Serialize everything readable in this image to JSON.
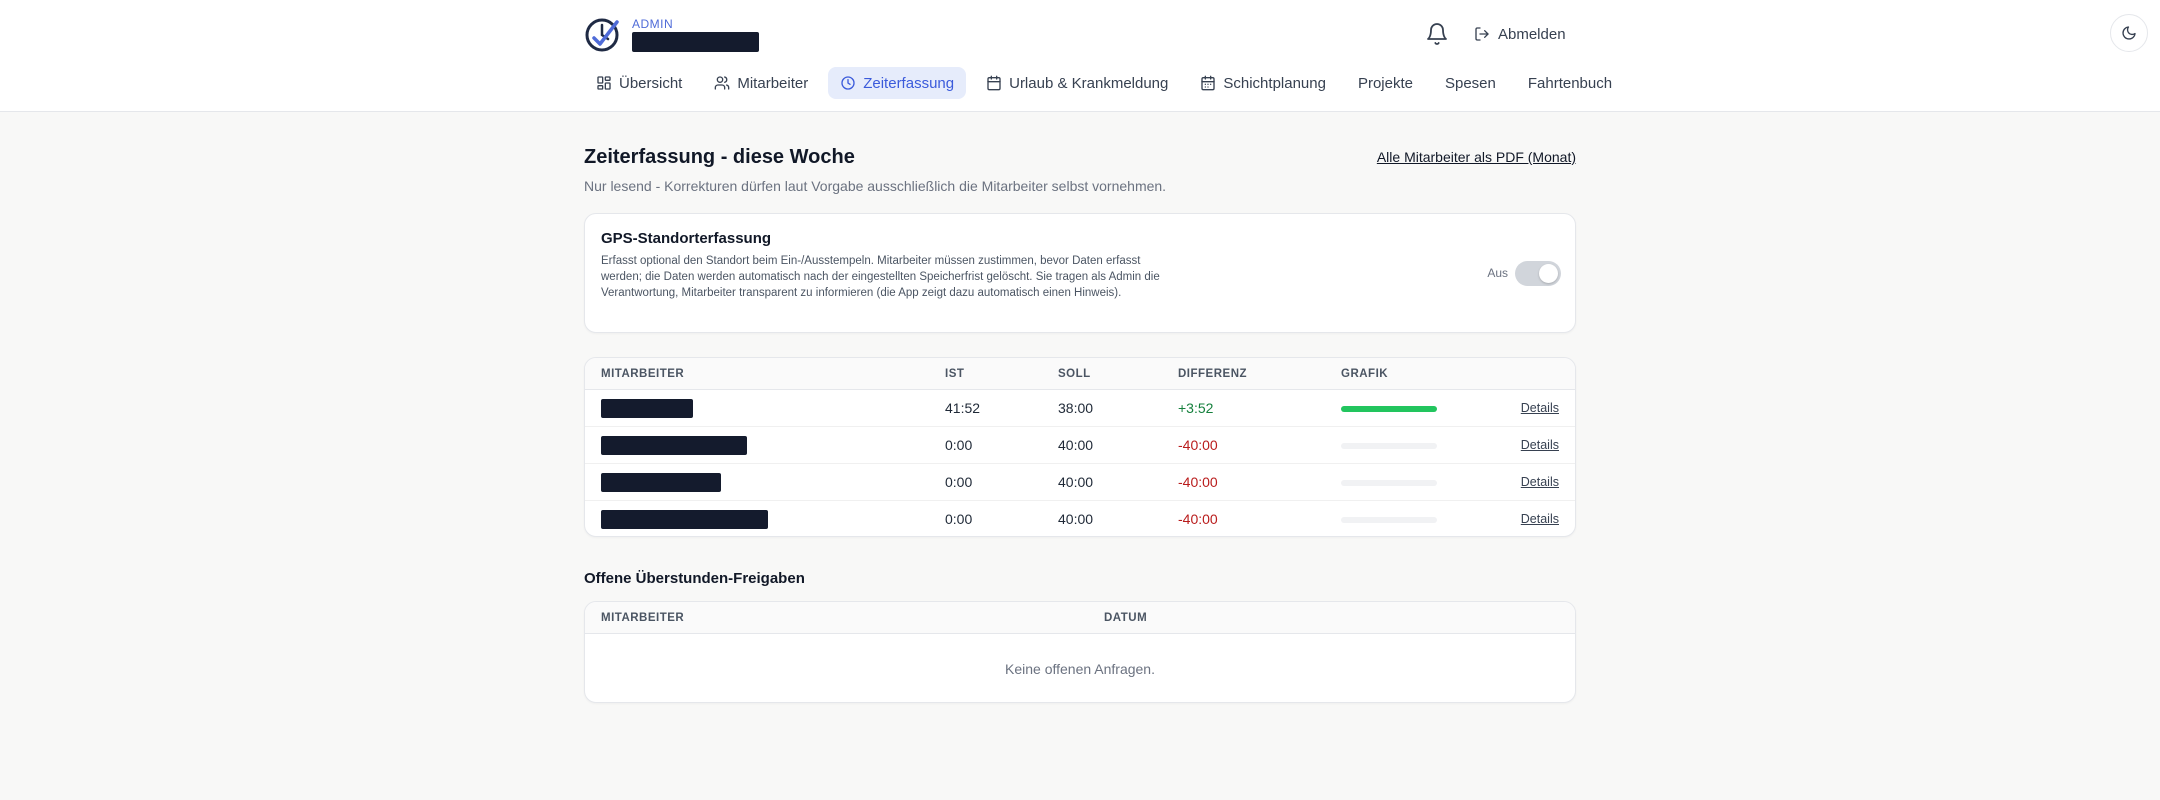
{
  "header": {
    "role": "ADMIN",
    "logout_label": "Abmelden"
  },
  "nav": [
    {
      "label": "Übersicht",
      "icon": "grid-icon"
    },
    {
      "label": "Mitarbeiter",
      "icon": "users-icon"
    },
    {
      "label": "Zeiterfassung",
      "icon": "clock-icon",
      "active": true
    },
    {
      "label": "Urlaub & Krankmeldung",
      "icon": "calendar-icon"
    },
    {
      "label": "Schichtplanung",
      "icon": "calendar-grid-icon"
    },
    {
      "label": "Projekte",
      "icon": ""
    },
    {
      "label": "Spesen",
      "icon": ""
    },
    {
      "label": "Fahrtenbuch",
      "icon": ""
    }
  ],
  "page": {
    "title": "Zeiterfassung - diese Woche",
    "subtitle": "Nur lesend - Korrekturen dürfen laut Vorgabe ausschließlich die Mitarbeiter selbst vornehmen.",
    "pdf_link": "Alle Mitarbeiter als PDF (Monat)"
  },
  "gps": {
    "title": "GPS-Standorterfassung",
    "description": "Erfasst optional den Standort beim Ein-/Ausstempeln. Mitarbeiter müssen zustimmen, bevor Daten erfasst werden; die Daten werden automatisch nach der eingestellten Speicherfrist gelöscht. Sie tragen als Admin die Verantwortung, Mitarbeiter transparent zu informieren (die App zeigt dazu automatisch einen Hinweis).",
    "toggle_label": "Aus",
    "enabled": false
  },
  "time_table": {
    "headers": {
      "employee": "MITARBEITER",
      "actual": "IST",
      "target": "SOLL",
      "difference": "DIFFERENZ",
      "chart": "GRAFIK"
    },
    "details_label": "Details",
    "rows": [
      {
        "actual": "41:52",
        "target": "38:00",
        "difference": "+3:52",
        "progress": 1.0
      },
      {
        "actual": "0:00",
        "target": "40:00",
        "difference": "-40:00",
        "progress": 0
      },
      {
        "actual": "0:00",
        "target": "40:00",
        "difference": "-40:00",
        "progress": 0
      },
      {
        "actual": "0:00",
        "target": "40:00",
        "difference": "-40:00",
        "progress": 0
      }
    ]
  },
  "overtime": {
    "title": "Offene Überstunden-Freigaben",
    "headers": {
      "employee": "MITARBEITER",
      "date": "DATUM"
    },
    "empty_text": "Keine offenen Anfragen."
  },
  "colors": {
    "accent": "#3b5bdb",
    "positive": "#15803d",
    "negative": "#b91c1c",
    "progress": "#22c55e"
  }
}
